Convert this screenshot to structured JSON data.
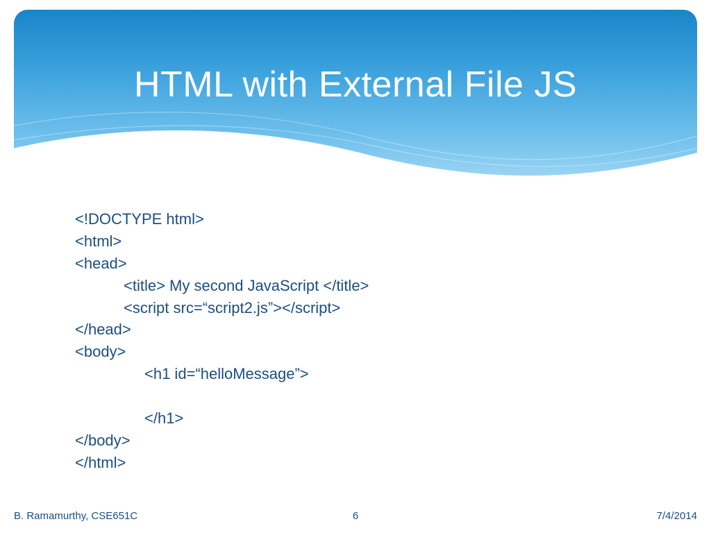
{
  "title": "HTML with External File JS",
  "code": {
    "l1": "<!DOCTYPE html>",
    "l2": "<html>",
    "l3": "<head>",
    "l4": "<title> My second JavaScript </title>",
    "l5": "<script src=“script2.js”></script>",
    "l6": "</head>",
    "l7": "<body>",
    "l8": "<h1 id=“helloMessage”>",
    "l9": "",
    "l10": "</h1>",
    "l11": "</body>",
    "l12": "</html>"
  },
  "footer": {
    "author": "B. Ramamurthy, CSE651C",
    "page": "6",
    "date": "7/4/2014"
  }
}
